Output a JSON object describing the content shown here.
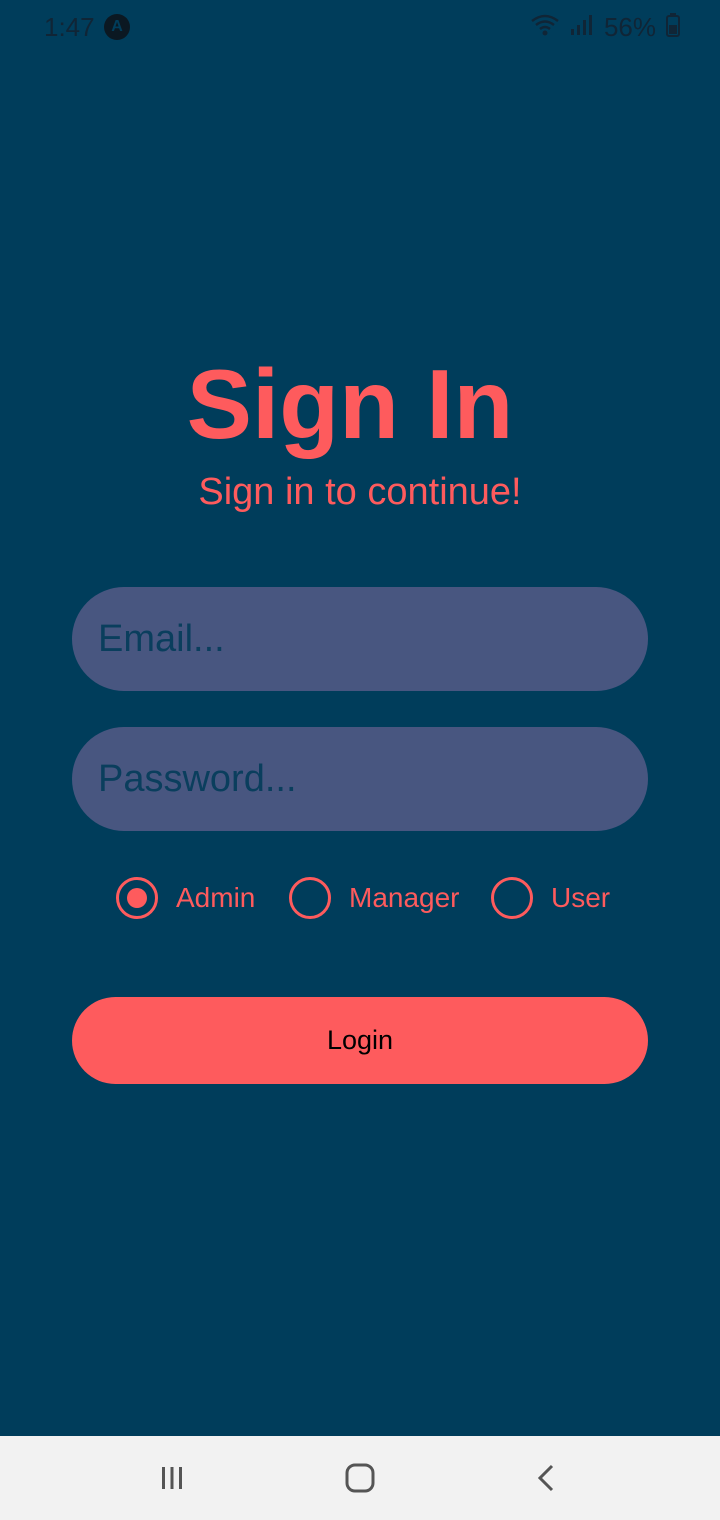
{
  "status_bar": {
    "time": "1:47",
    "battery": "56%",
    "icons": [
      "app-notification-icon",
      "wifi-icon",
      "signal-icon",
      "battery-icon"
    ]
  },
  "screen": {
    "title": "Sign In",
    "subtitle": "Sign in to continue!"
  },
  "form": {
    "email_placeholder": "Email...",
    "password_placeholder": "Password...",
    "roles": [
      {
        "label": "Admin",
        "selected": true
      },
      {
        "label": "Manager",
        "selected": false
      },
      {
        "label": "User",
        "selected": false
      }
    ],
    "login_label": "Login"
  },
  "nav_bar": {
    "icons": [
      "recent-apps-icon",
      "home-icon",
      "back-icon"
    ]
  },
  "colors": {
    "background": "#003d5b",
    "accent": "#fe5b5d",
    "input_background": "#485680",
    "nav_background": "#f2f2f2"
  }
}
